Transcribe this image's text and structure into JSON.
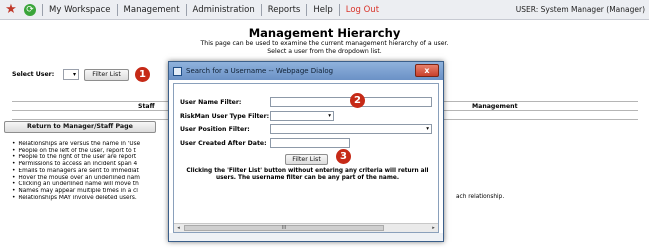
{
  "nav": {
    "star_icon": "star-icon",
    "refresh_icon": "refresh-icon",
    "items": [
      "My Workspace",
      "Management",
      "Administration",
      "Reports",
      "Help",
      "Log Out"
    ],
    "user": "USER: System Manager (Manager)",
    "logout_color": "#d9342b"
  },
  "header": {
    "title": "Management Hierarchy",
    "desc_line1": "This page can be used to examine the current management hierarchy of a user.",
    "desc_line2": "Select a user from the dropdown list."
  },
  "select_user": {
    "label": "Select User:",
    "value": "▾",
    "filter_button": "Filter List"
  },
  "table": {
    "staff_header": "Staff",
    "management_header": "Management",
    "return_button": "Return to Manager/Staff Page"
  },
  "notes": [
    "Relationships are versus the name in 'Use",
    "People on the left of the user, report to t",
    "People to the right of the user are report",
    "Permissions to access an incident span 4",
    "Emails to managers are sent to immediat",
    "Hover the mouse over an underlined nam",
    "Clicking an underlined name will move th",
    "Names may appear multiple times in a cl",
    "Relationships MAY involve deleted users."
  ],
  "peek_text": "ach relationship.",
  "badges": [
    "1",
    "2",
    "3"
  ],
  "badge_color": "#c62a17",
  "dialog": {
    "title": "Search for a Username -- Webpage Dialog",
    "close": "x",
    "fields": {
      "username_filter": {
        "label": "User Name Filter:",
        "value": ""
      },
      "type_filter": {
        "label": "RiskMan User Type Filter:",
        "value": "▾"
      },
      "position_filter": {
        "label": "User Position Filter:",
        "value": "▾"
      },
      "created_after": {
        "label": "User Created After Date:",
        "value": ""
      }
    },
    "filter_button": "Filter List",
    "note": "Clicking the 'Filter List' button without entering any criteria will return all users. The username filter can be any part of the name.",
    "scroll_left": "◂",
    "scroll_right": "▸",
    "scroll_thumb": "III"
  }
}
